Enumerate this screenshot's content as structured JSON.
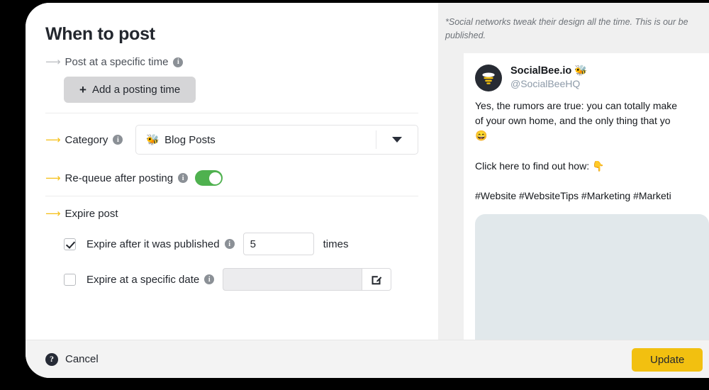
{
  "panel": {
    "title": "When to post"
  },
  "schedule": {
    "arrow_icon": "arrow-right-icon",
    "label": "Post at a specific time",
    "info_icon": "info-icon",
    "add_button_label": "Add a posting time",
    "add_button_plus": "+"
  },
  "category": {
    "arrow_icon": "arrow-right-icon",
    "label": "Category",
    "info_icon": "info-icon",
    "selected_emoji": "🐝",
    "selected_value": "Blog Posts",
    "caret_icon": "chevron-down-icon"
  },
  "requeue": {
    "arrow_icon": "arrow-right-icon",
    "label": "Re-queue after posting",
    "info_icon": "info-icon",
    "state": "on"
  },
  "expire": {
    "arrow_icon": "arrow-right-icon",
    "section_label": "Expire post",
    "after_published": {
      "checked": true,
      "label": "Expire after it was published",
      "info_icon": "info-icon",
      "count_value": "5",
      "suffix_label": "times"
    },
    "specific_date": {
      "checked": false,
      "label": "Expire at a specific date",
      "info_icon": "info-icon",
      "date_value": "",
      "date_placeholder": "",
      "picker_icon": "calendar-edit-icon"
    }
  },
  "preview": {
    "disclaimer": "*Social networks tweak their design all the time. This is our be\npublished.",
    "tweet": {
      "avatar_icon": "bee-avatar-icon",
      "account_name": "SocialBee.io 🐝",
      "handle": "@SocialBeeHQ",
      "body": "Yes, the rumors are true: you can totally make\nof your own home, and the only thing that yo\n😄\n\nClick here to find out how: 👇\n\n#Website #WebsiteTips #Marketing #Marketi",
      "image_placeholder": "image-attachment"
    }
  },
  "footer": {
    "cancel_label": "Cancel",
    "help_icon": "help-question-icon",
    "update_label": "Update"
  },
  "colors": {
    "accent_yellow": "#f2c010",
    "toggle_green": "#4fb14f",
    "arrow_gold": "#f5bf16",
    "arrow_gray": "#b9bcc0"
  }
}
